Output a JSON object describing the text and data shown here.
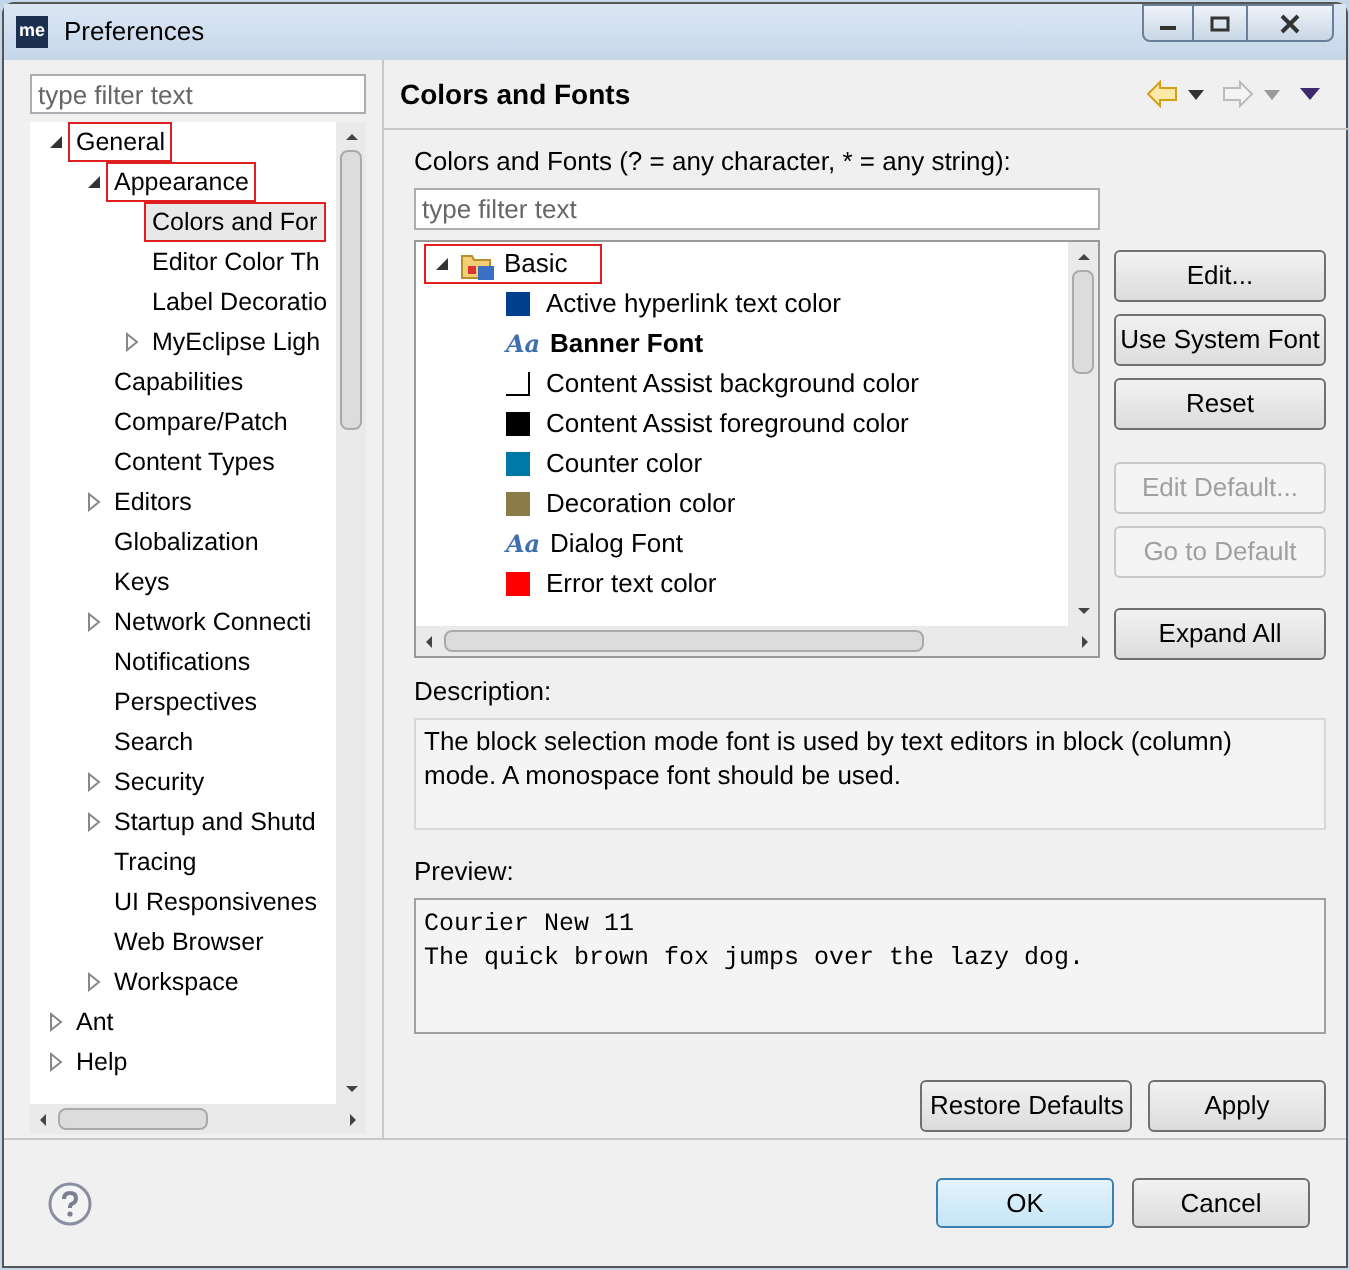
{
  "window": {
    "title": "Preferences",
    "app_badge": "me"
  },
  "left": {
    "filter": {
      "placeholder": "type filter text"
    },
    "tree": [
      {
        "label": "General",
        "expanded": true,
        "selected": false,
        "marked": true,
        "children": [
          {
            "label": "Appearance",
            "expanded": true,
            "selected": false,
            "marked": true,
            "children": [
              {
                "label": "Colors and For",
                "selected": true,
                "marked": true
              },
              {
                "label": "Editor Color Th",
                "selected": false,
                "marked": false
              },
              {
                "label": "Label Decoratio",
                "selected": false,
                "marked": false
              },
              {
                "label": "MyEclipse Ligh",
                "expanded": false,
                "selected": false,
                "marked": false
              }
            ]
          },
          {
            "label": "Capabilities",
            "selected": false,
            "marked": false
          },
          {
            "label": "Compare/Patch",
            "selected": false,
            "marked": false
          },
          {
            "label": "Content Types",
            "selected": false,
            "marked": false
          },
          {
            "label": "Editors",
            "expanded": false,
            "selected": false,
            "marked": false
          },
          {
            "label": "Globalization",
            "selected": false,
            "marked": false
          },
          {
            "label": "Keys",
            "selected": false,
            "marked": false
          },
          {
            "label": "Network Connecti",
            "expanded": false,
            "selected": false,
            "marked": false
          },
          {
            "label": "Notifications",
            "selected": false,
            "marked": false
          },
          {
            "label": "Perspectives",
            "selected": false,
            "marked": false
          },
          {
            "label": "Search",
            "selected": false,
            "marked": false
          },
          {
            "label": "Security",
            "expanded": false,
            "selected": false,
            "marked": false
          },
          {
            "label": "Startup and Shutd",
            "expanded": false,
            "selected": false,
            "marked": false
          },
          {
            "label": "Tracing",
            "selected": false,
            "marked": false
          },
          {
            "label": "UI Responsivenes",
            "selected": false,
            "marked": false
          },
          {
            "label": "Web Browser",
            "selected": false,
            "marked": false
          },
          {
            "label": "Workspace",
            "expanded": false,
            "selected": false,
            "marked": false
          }
        ]
      },
      {
        "label": "Ant",
        "expanded": false,
        "selected": false,
        "marked": false
      },
      {
        "label": "Help",
        "expanded": false,
        "selected": false,
        "marked": false
      }
    ]
  },
  "page": {
    "title": "Colors and Fonts",
    "filter_label": "Colors and Fonts (? = any character, * = any string):",
    "filter": {
      "placeholder": "type filter text"
    },
    "tree": {
      "label": "Basic",
      "expanded": true,
      "marked": true,
      "items": [
        {
          "kind": "color",
          "label": "Active hyperlink text color",
          "color": "#003f8c"
        },
        {
          "kind": "font",
          "glyph": "Aa",
          "label": "Banner Font",
          "bold": true
        },
        {
          "kind": "color",
          "label": "Content Assist background color",
          "color": "#ffffff"
        },
        {
          "kind": "color",
          "label": "Content Assist foreground color",
          "color": "#000000"
        },
        {
          "kind": "color",
          "label": "Counter color",
          "color": "#0078a8"
        },
        {
          "kind": "color",
          "label": "Decoration color",
          "color": "#8c7a48"
        },
        {
          "kind": "font",
          "glyph": "Aa",
          "label": "Dialog Font",
          "bold": false
        },
        {
          "kind": "color",
          "label": "Error text color",
          "color": "#ff0000"
        }
      ]
    },
    "side_buttons": [
      {
        "label": "Edit...",
        "disabled": false
      },
      {
        "label": "Use System Font",
        "disabled": false
      },
      {
        "label": "Reset",
        "disabled": false
      },
      {
        "label": "Edit Default...",
        "disabled": true
      },
      {
        "label": "Go to Default",
        "disabled": true
      },
      {
        "label": "Expand All",
        "disabled": false
      }
    ],
    "description_label": "Description:",
    "description": "The block selection mode font is used by text editors in block (column) mode. A monospace font should be used.",
    "preview_label": "Preview:",
    "preview": [
      "Courier New 11",
      "The quick brown fox jumps over the lazy dog."
    ],
    "buttons": [
      "Restore Defaults",
      "Apply"
    ]
  },
  "footer": {
    "buttons": [
      {
        "label": "OK",
        "default": true
      },
      {
        "label": "Cancel",
        "default": false
      }
    ]
  }
}
